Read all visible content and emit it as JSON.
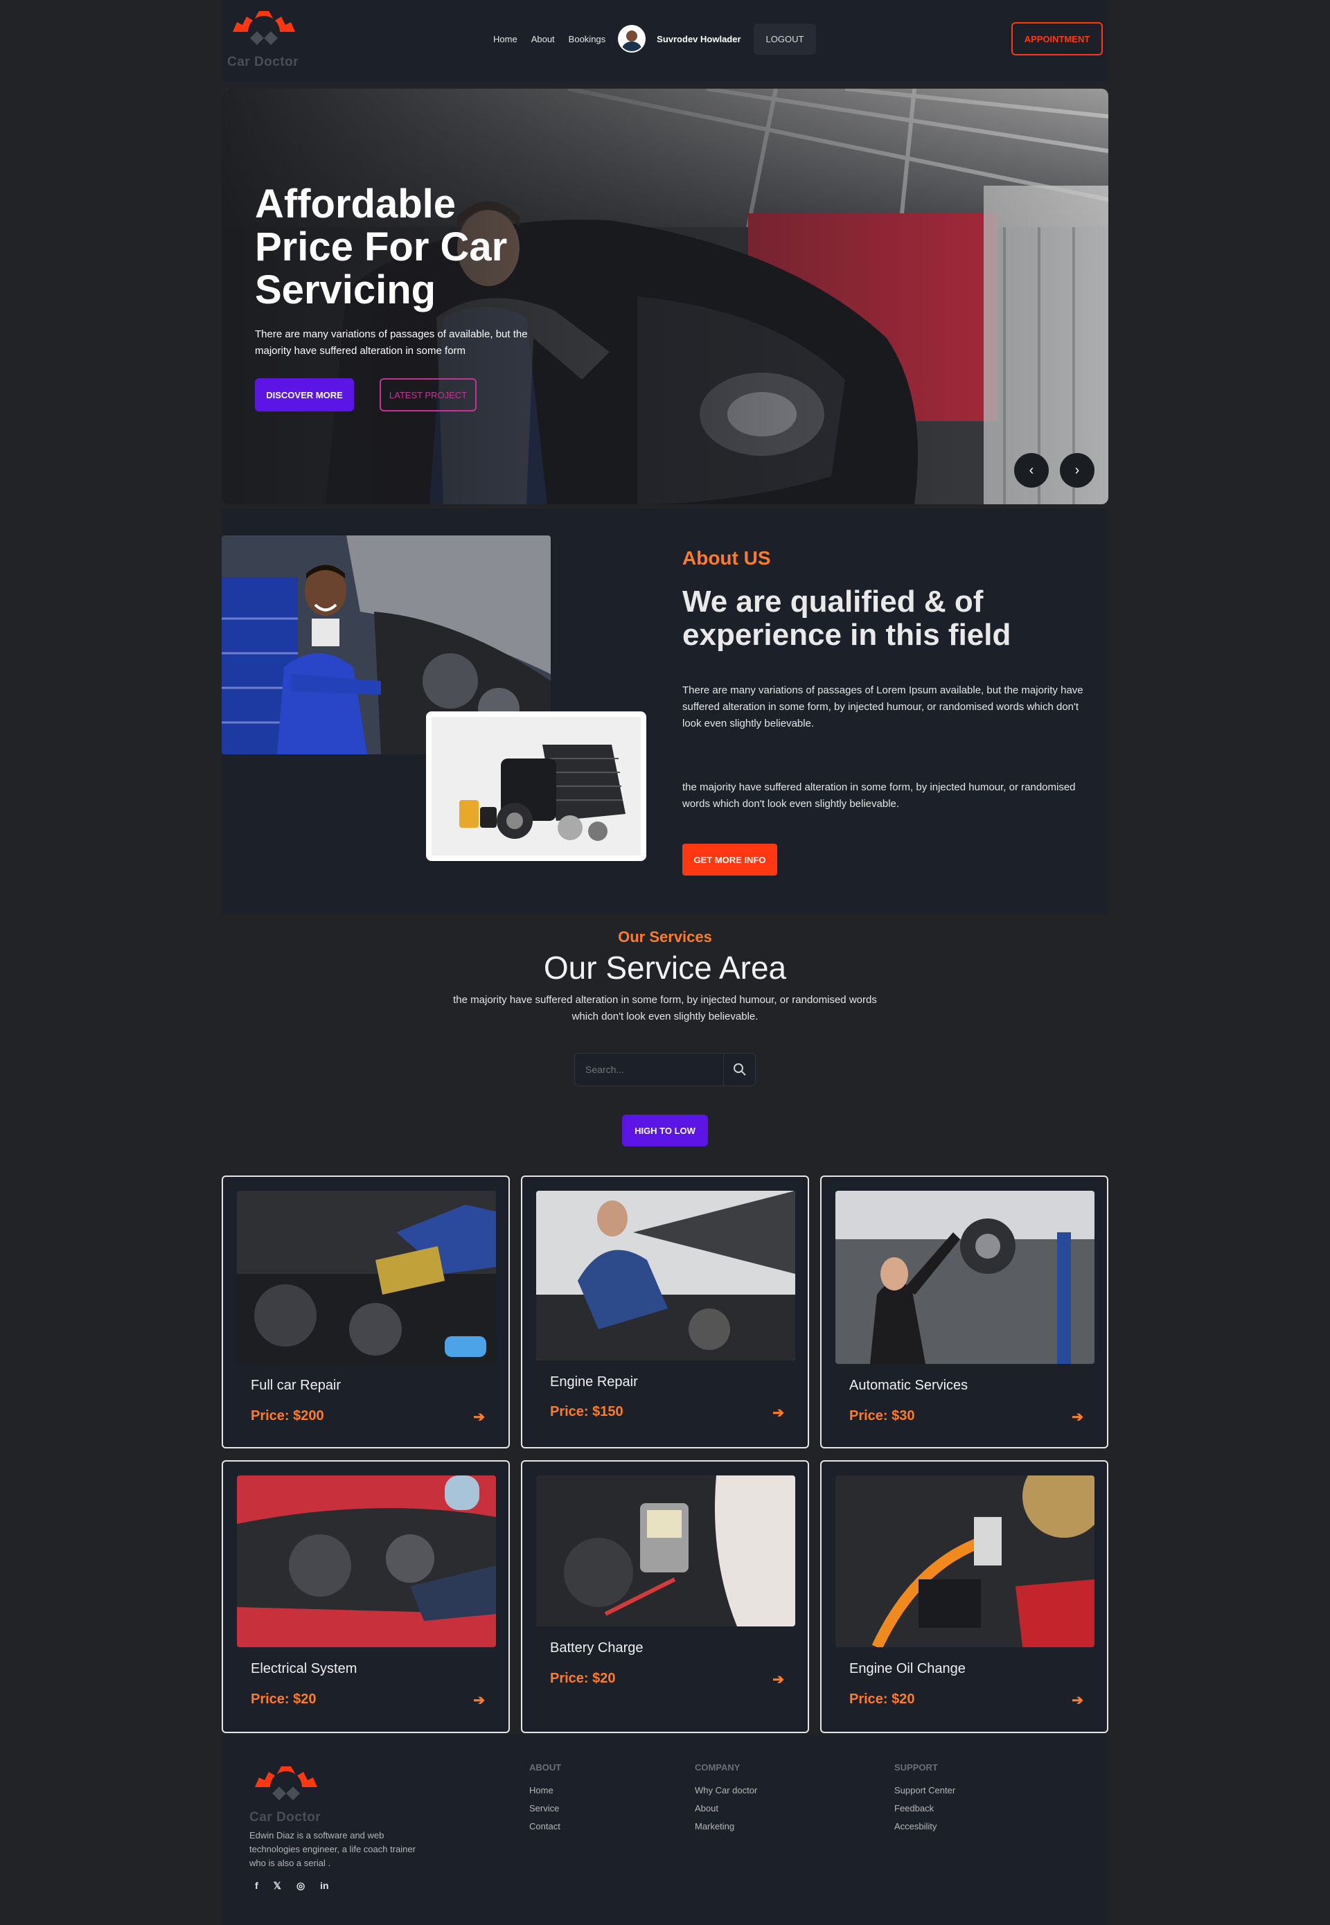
{
  "brand": {
    "name": "Car Doctor",
    "accent": "#ff3811",
    "orange": "#ff7c26",
    "purple": "#5b16e6"
  },
  "nav": {
    "links": [
      "Home",
      "About",
      "Bookings"
    ],
    "user_name": "Suvrodev Howlader",
    "logout": "LOGOUT",
    "appointment": "APPOINTMENT"
  },
  "hero": {
    "title": "Affordable Price For Car Servicing",
    "description": "There are many variations of passages of available, but the majority have suffered alteration in some form",
    "discover": "DISCOVER MORE",
    "latest": "LATEST PROJECT",
    "prev": "‹",
    "next": "›"
  },
  "about": {
    "subtitle": "About US",
    "title": "We are qualified & of experience in this field",
    "para1": "There are many variations of passages of Lorem Ipsum available, but the majority have suffered alteration in some form, by injected humour, or randomised words which don't look even slightly believable.",
    "para2": "the majority have suffered alteration in some form, by injected humour, or randomised words which don't look even slightly believable.",
    "button": "GET MORE INFO"
  },
  "services": {
    "subtitle": "Our Services",
    "title": "Our Service Area",
    "description": "the majority have suffered alteration in some form, by injected humour, or randomised words which don't look even slightly believable.",
    "search_placeholder": "Search...",
    "sort_button": "HIGH TO LOW",
    "items": [
      {
        "name": "Full car Repair",
        "price": "Price: $200",
        "icon": "arrow-right-icon"
      },
      {
        "name": "Engine Repair",
        "price": "Price: $150",
        "icon": "arrow-right-icon"
      },
      {
        "name": "Automatic Services",
        "price": "Price: $30",
        "icon": "arrow-right-icon"
      },
      {
        "name": "Electrical System",
        "price": "Price: $20",
        "icon": "arrow-right-icon"
      },
      {
        "name": "Battery Charge",
        "price": "Price: $20",
        "icon": "arrow-right-icon"
      },
      {
        "name": "Engine Oil Change",
        "price": "Price: $20",
        "icon": "arrow-right-icon"
      }
    ]
  },
  "footer": {
    "brand": "Car Doctor",
    "description": "Edwin Diaz is a software and web technologies engineer, a life coach trainer who is also a serial .",
    "social": [
      "facebook-icon",
      "x-icon",
      "instagram-icon",
      "linkedin-icon"
    ],
    "columns": [
      {
        "title": "ABOUT",
        "links": [
          "Home",
          "Service",
          "Contact"
        ]
      },
      {
        "title": "COMPANY",
        "links": [
          "Why Car doctor",
          "About",
          "Marketing"
        ]
      },
      {
        "title": "SUPPORT",
        "links": [
          "Support Center",
          "Feedback",
          "Accesbility"
        ]
      }
    ]
  }
}
